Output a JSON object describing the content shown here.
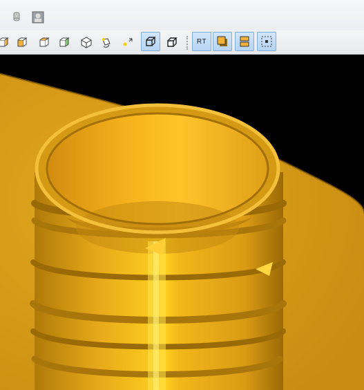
{
  "window": {
    "top_icons": [
      "cylinder-db-icon",
      "portrait-image-icon"
    ]
  },
  "toolbar": {
    "rt_label": "RT",
    "tools": [
      "view-left-icon",
      "view-right-icon",
      "view-front-icon",
      "view-back-icon",
      "view-iso-icon",
      "rotate-view-icon",
      "pan-view-icon",
      "shaded-cube-icon",
      "wire-cube-icon",
      "raytrace-button",
      "shaded-mode-icon",
      "split-view-icon",
      "fit-selection-icon"
    ],
    "active_tools": [
      "shaded-cube-icon",
      "raytrace-button",
      "shaded-mode-icon",
      "split-view-icon",
      "fit-selection-icon"
    ]
  },
  "viewport": {
    "background": "#000000",
    "object": "threaded-bottle-neck-3d",
    "material_color": "#e8a317"
  }
}
